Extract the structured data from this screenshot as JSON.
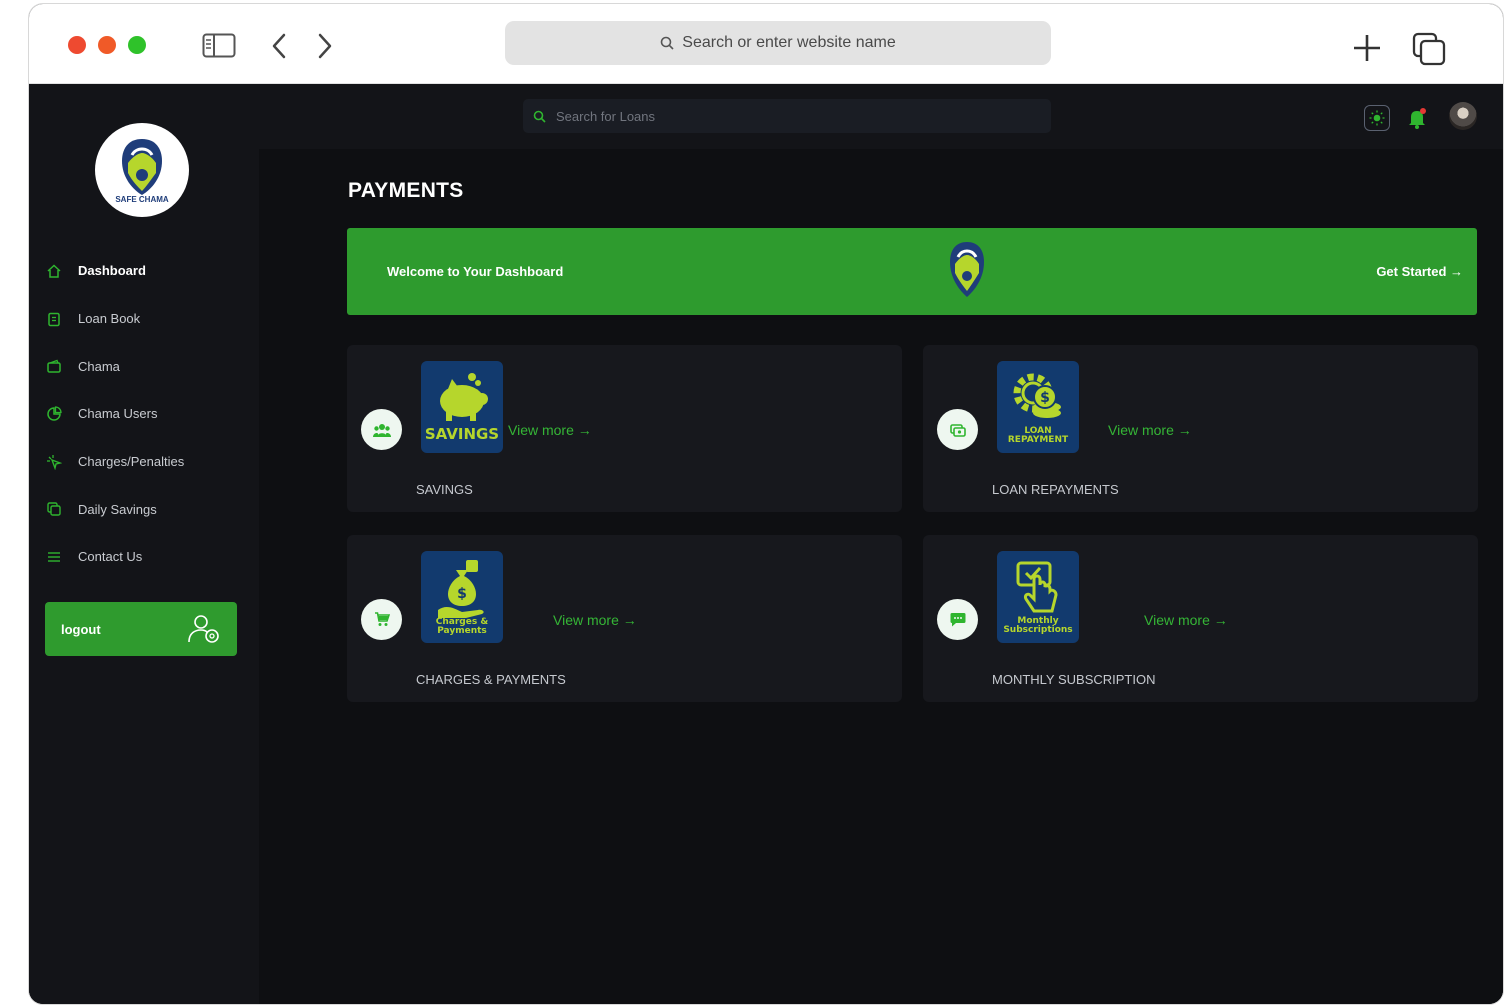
{
  "browser": {
    "url_placeholder": "Search or enter website name",
    "traffic_light_colors": [
      "#ee4a30",
      "#f05a28",
      "#2fc22a"
    ]
  },
  "topbar": {
    "search_placeholder": "Search for Loans",
    "icons": [
      "theme-toggle-icon",
      "bell-icon",
      "avatar"
    ]
  },
  "sidebar": {
    "logo_text": "SAFE CHAMA",
    "items": [
      {
        "label": "Dashboard",
        "icon": "home-icon",
        "active": true
      },
      {
        "label": "Loan Book",
        "icon": "clipboard-icon",
        "active": false
      },
      {
        "label": "Chama",
        "icon": "wallet-icon",
        "active": false
      },
      {
        "label": "Chama Users",
        "icon": "pie-chart-icon",
        "active": false
      },
      {
        "label": "Charges/Penalties",
        "icon": "cursor-click-icon",
        "active": false
      },
      {
        "label": "Daily Savings",
        "icon": "copy-icon",
        "active": false
      },
      {
        "label": "Contact Us",
        "icon": "list-icon",
        "active": false
      }
    ],
    "logout_label": "logout"
  },
  "main": {
    "title": "PAYMENTS",
    "banner": {
      "text": "Welcome to Your Dashboard",
      "cta": "Get Started →"
    },
    "cards": [
      {
        "label": "SAVINGS",
        "tile_text": "SAVINGS",
        "link": "View more →",
        "icon": "users-icon"
      },
      {
        "label": "LOAN REPAYMENTS",
        "tile_text": "LOAN REPAYMENT",
        "link": "View more →",
        "icon": "cash-icon"
      },
      {
        "label": "CHARGES & PAYMENTS",
        "tile_text": "Charges & Payments",
        "link": "View more →",
        "icon": "cart-icon"
      },
      {
        "label": "MONTHLY SUBSCRIPTION",
        "tile_text": "Monthly Subscriptions",
        "link": "View more →",
        "icon": "chat-icon"
      }
    ]
  },
  "colors": {
    "accent_green": "#2e9b2e",
    "link_green": "#35b536",
    "tile_blue": "#123a6e",
    "tile_lime": "#b6d62c",
    "background": "#0e0f12",
    "sidebar_bg": "#131418"
  }
}
